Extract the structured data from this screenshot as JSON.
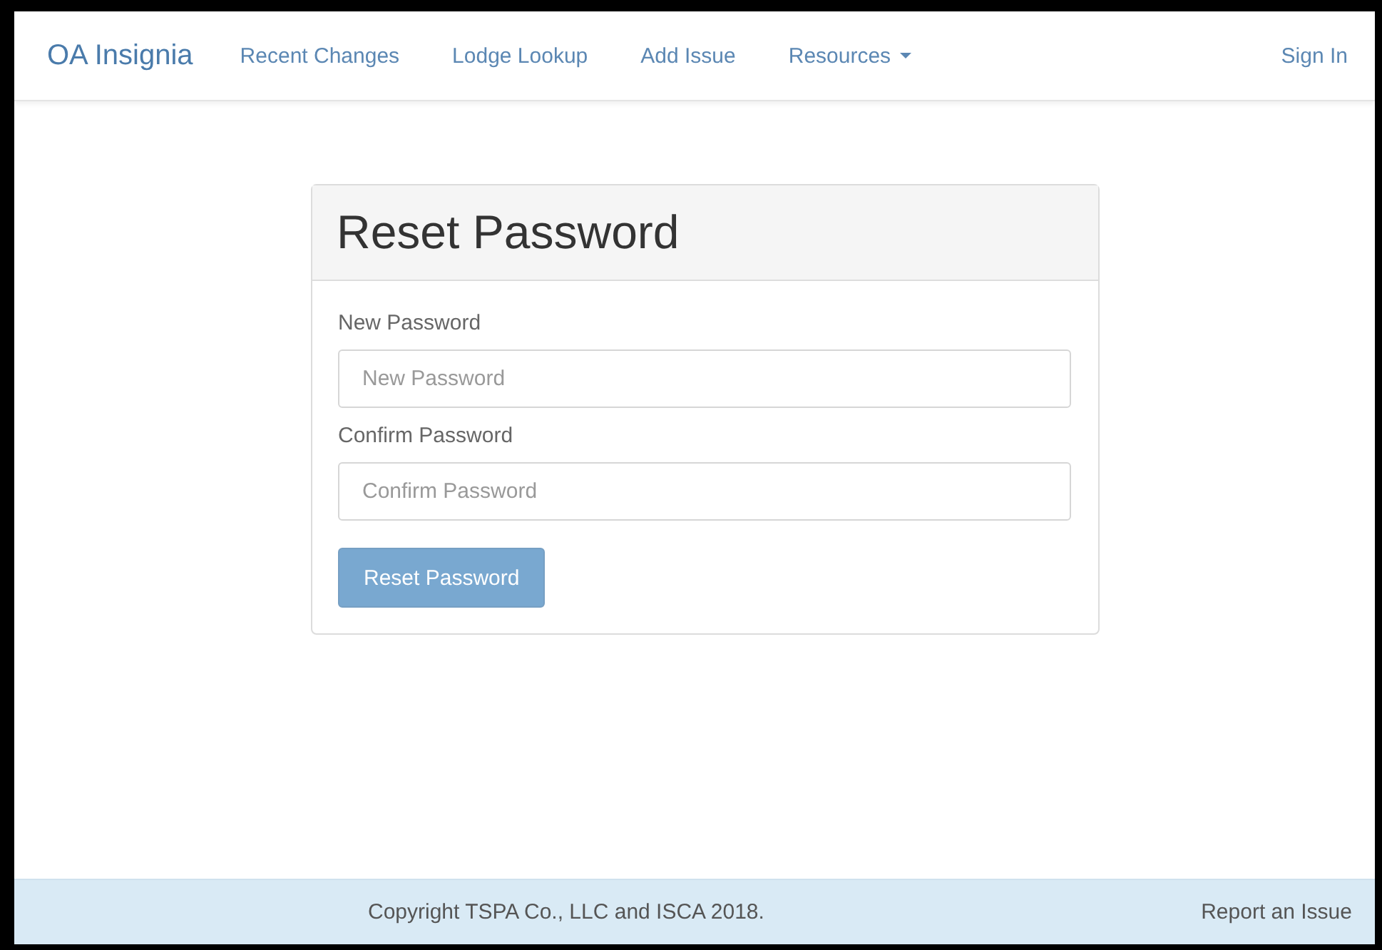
{
  "navbar": {
    "brand": "OA Insignia",
    "links": [
      {
        "label": "Recent Changes",
        "kind": "link"
      },
      {
        "label": "Lodge Lookup",
        "kind": "link"
      },
      {
        "label": "Add Issue",
        "kind": "link"
      },
      {
        "label": "Resources",
        "kind": "dropdown"
      }
    ],
    "right_link": "Sign In"
  },
  "panel": {
    "title": "Reset Password",
    "fields": [
      {
        "label": "New Password",
        "placeholder": "New Password"
      },
      {
        "label": "Confirm Password",
        "placeholder": "Confirm Password"
      }
    ],
    "button": {
      "label": "Reset Password",
      "disabled": true
    }
  },
  "footer": {
    "copyright": "Copyright TSPA Co., LLC and ISCA 2018.",
    "link": "Report an Issue"
  }
}
